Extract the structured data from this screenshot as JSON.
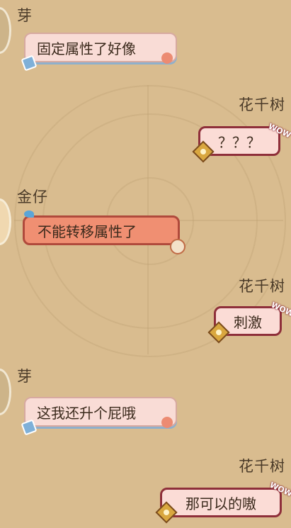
{
  "messages": [
    {
      "sender": "芽",
      "text": "固定属性了好像"
    },
    {
      "sender": "花千树",
      "text": "？？？"
    },
    {
      "sender": "金仔",
      "text": "不能转移属性了"
    },
    {
      "sender": "花千树",
      "text": "刺激"
    },
    {
      "sender": "芽",
      "text": "这我还升个屁哦"
    },
    {
      "sender": "花千树",
      "text": "那可以的嗷"
    }
  ],
  "icons": {
    "wow": "WOW",
    "tag": "tag-icon",
    "balloon": "balloon-icon",
    "star_badge": "star-badge-icon",
    "bird": "bird-icon",
    "fruit": "fruit-icon"
  }
}
